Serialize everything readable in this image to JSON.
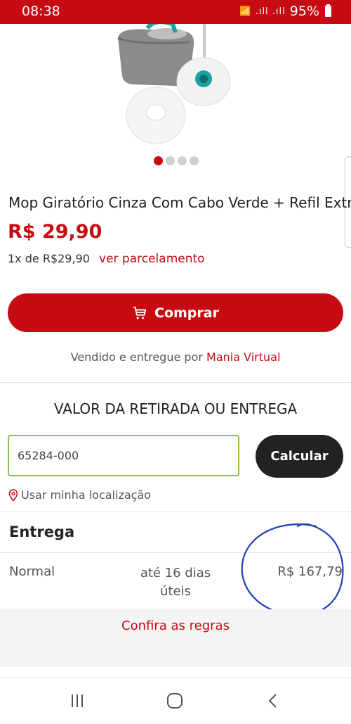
{
  "status": {
    "time": "08:38",
    "signal_icons": "📶 .ıll .ıll",
    "battery": "95%"
  },
  "product": {
    "title": "Mop Giratório Cinza Com Cabo Verde + Refil Extra",
    "price": "R$ 29,90",
    "installments_text": "1x de R$29,90",
    "installments_link": "ver parcelamento",
    "image_index": 1,
    "image_count": 4
  },
  "buy": {
    "label": "Comprar"
  },
  "seller": {
    "prefix": "Vendido e entregue por",
    "name": "Mania Virtual"
  },
  "shipping": {
    "section_title": "VALOR DA RETIRADA OU ENTREGA",
    "cep_value": "65284-000",
    "calc_label": "Calcular",
    "use_location": "Usar minha localização"
  },
  "delivery": {
    "title": "Entrega",
    "option": {
      "name": "Normal",
      "time": "até 16 dias úteis",
      "price": "R$ 167,79"
    },
    "rules_link": "Confira as regras"
  },
  "colors": {
    "brand": "#c70b12",
    "input_border": "#8bc34a",
    "annotation": "#1e3fb5"
  },
  "nav_icons": [
    "recent-apps-icon",
    "home-icon",
    "back-icon"
  ]
}
